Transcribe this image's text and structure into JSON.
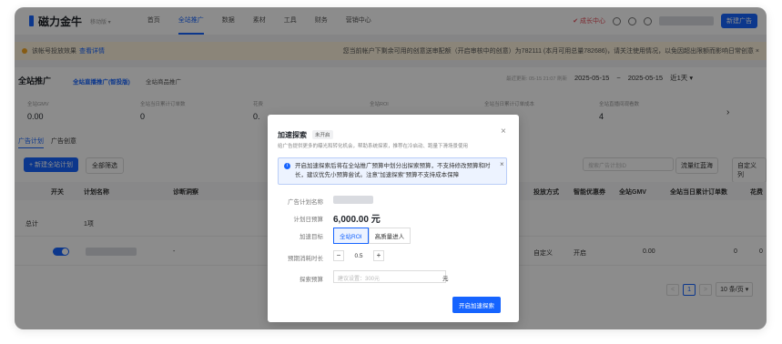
{
  "brand": {
    "name": "磁力金牛",
    "sub": "移动版 ▾"
  },
  "topnav": {
    "items": [
      "首页",
      "全站推广",
      "数据",
      "素材",
      "工具",
      "财务",
      "营销中心"
    ],
    "growth": "✔ 成长中心",
    "account_button": "新建广告"
  },
  "notice": {
    "text": "该帐号投放效果",
    "link": "查看详情",
    "warning": "您当前帐户下剩余可用的创意送审配额（开启审核中的创意）为782111 (本月可用总量782686)，请关注使用情况，以免因超出限额而影响日常创意 ×"
  },
  "header": {
    "title": "全站推广",
    "tab_active": "全站直播推广(智投版)",
    "tab_other": "全站商品推广",
    "update_text": "最近更新: 05-15 21:07 刷新",
    "date_start": "2025-05-15",
    "date_sep": "~",
    "date_end": "2025-05-15",
    "range": "近1天 ▾"
  },
  "metrics": [
    {
      "label": "全站GMV",
      "value": "0.00"
    },
    {
      "label": "全站当日累计订单数",
      "value": "0"
    },
    {
      "label": "花费",
      "value": "0."
    },
    {
      "label": "全站ROI",
      "value": ""
    },
    {
      "label": "全站当日累计订单成本",
      "value": ""
    },
    {
      "label": "全站直播间观看数",
      "value": "4"
    }
  ],
  "list": {
    "tab_plan": "广告计划",
    "tab_creative": "广告创意",
    "new_button": "+ 新建全站计划",
    "filter_button": "全部筛选",
    "search_placeholder": "搜索广告计划ID",
    "btn_red_sea": "流量红蓝海",
    "btn_custom": "自定义列",
    "columns": [
      "开关",
      "计划名称",
      "诊断洞察",
      "投放方式",
      "智能优惠券",
      "全站GMV",
      "全站当日累计订单数",
      "花费"
    ],
    "summary_row": {
      "label": "总计",
      "count": "1项"
    },
    "data_row": {
      "diagnosis": "-",
      "mode": "自定义",
      "coupon": "开启",
      "gmv": "0.00",
      "orders": "0",
      "cost": "0"
    },
    "pager": {
      "prev": "<",
      "page": "1",
      "next": ">",
      "size": "10 条/页 ▾"
    }
  },
  "modal": {
    "title": "加速探索",
    "badge": "未开启",
    "subtitle": "给广告提供更多的曝光和转化机会，帮助系统探索，推荐在冷启动、跑量下滑场景使用",
    "info": "开启加速探索后将在全站推广预算中划分出探索预算，不支持修改预算和时长，建议优先小预算尝试。注意\"加速探索\"预算不支持成本保障",
    "field_plan_name": "广告计划名称",
    "field_budget": "计划日预算",
    "budget_value": "6,000.00 元",
    "field_target": "加速目标",
    "target_options": [
      "全站ROI",
      "高质量进人"
    ],
    "field_duration": "预期消耗时长",
    "duration_value": "0.5",
    "field_explore_budget": "探索预算",
    "explore_placeholder": "建议设置：300元",
    "explore_unit": "元",
    "submit": "开启加速探索"
  }
}
